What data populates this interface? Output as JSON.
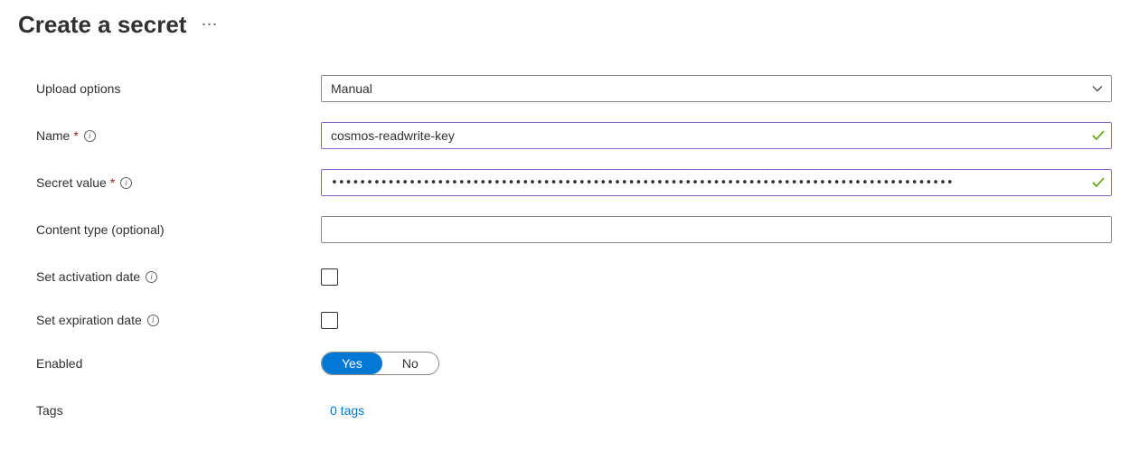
{
  "header": {
    "title": "Create a secret"
  },
  "form": {
    "uploadOptions": {
      "label": "Upload options",
      "value": "Manual"
    },
    "name": {
      "label": "Name",
      "value": "cosmos-readwrite-key"
    },
    "secretValue": {
      "label": "Secret value",
      "masked": "••••••••••••••••••••••••••••••••••••••••••••••••••••••••••••••••••••••••••••••••••••••••"
    },
    "contentType": {
      "label": "Content type (optional)",
      "value": ""
    },
    "activationDate": {
      "label": "Set activation date",
      "checked": false
    },
    "expirationDate": {
      "label": "Set expiration date",
      "checked": false
    },
    "enabled": {
      "label": "Enabled",
      "yes": "Yes",
      "no": "No",
      "value": "Yes"
    },
    "tags": {
      "label": "Tags",
      "link": "0 tags"
    }
  }
}
